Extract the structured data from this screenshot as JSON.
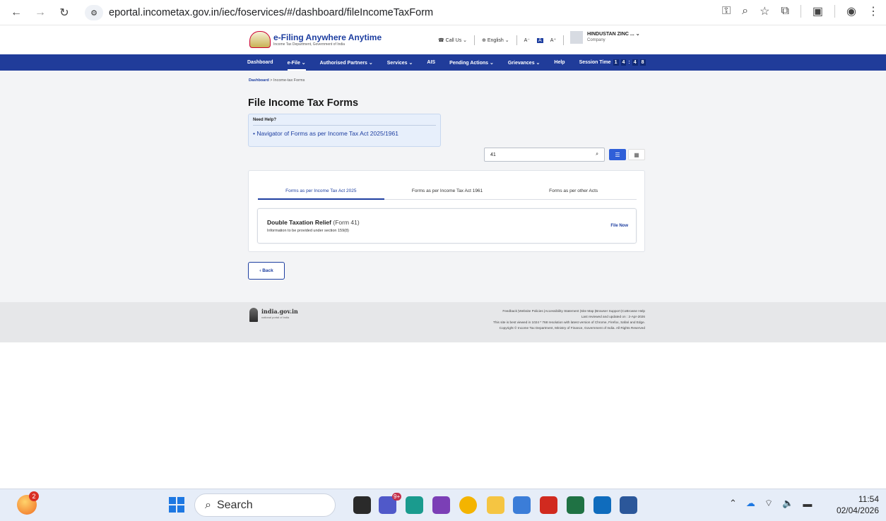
{
  "browser": {
    "url": "eportal.incometax.gov.in/iec/foservices/#/dashboard/fileIncomeTaxForm"
  },
  "header": {
    "logo_title": "e-Filing Anywhere Anytime",
    "logo_subtitle": "Income Tax Department, Government of India",
    "call_us": "Call Us",
    "language": "English",
    "font_small": "A⁻",
    "font_normal": "A",
    "font_large": "A⁺",
    "contrast": "◑",
    "user_name": "HINDUSTAN ZINC ...",
    "user_type": "Company"
  },
  "nav": {
    "items": [
      {
        "label": "Dashboard"
      },
      {
        "label": "e-File ⌄"
      },
      {
        "label": "Authorised Partners ⌄"
      },
      {
        "label": "Services ⌄"
      },
      {
        "label": "AIS"
      },
      {
        "label": "Pending Actions ⌄"
      },
      {
        "label": "Grievances ⌄"
      },
      {
        "label": "Help"
      }
    ],
    "session_label": "Session Time",
    "session_digits": [
      "1",
      "4",
      ":",
      "4",
      "8"
    ]
  },
  "main": {
    "breadcrumb": {
      "home": "Dashboard",
      "separator": ">",
      "current": "Income-tax Forms"
    },
    "title": "File Income Tax Forms",
    "help": {
      "title": "Need Help?",
      "link": "Navigator of Forms as per Income Tax Act 2025/1961"
    },
    "search": {
      "value": "41"
    },
    "tabs": [
      {
        "label": "Forms as per Income Tax Act 2025"
      },
      {
        "label": "Forms as per Income Tax Act 1961"
      },
      {
        "label": "Forms as per other Acts"
      }
    ],
    "form": {
      "name": "Double Taxation Relief",
      "code": "(Form 41)",
      "description": "Information to be provided under section 159(8)",
      "action": "File Now"
    },
    "back": "Back"
  },
  "footer": {
    "india_title": "india.gov.in",
    "india_sub": "national portal of india",
    "links": "Feedback |Website Policies |Accessibility Statement |Site Map |Browser Support |CoBrowse Help",
    "reviewed": "Last reviewed and updated on : 2-Apr-2026",
    "resolution": "This site is best viewed in 1024 * 768 resolution with latest version of Chrome, Firefox, Safari and Edge.",
    "copyright": "Copyright © Income Tax Department, Ministry of Finance, Government of India. All Rights Reserved"
  },
  "taskbar": {
    "search_placeholder": "Search",
    "badge_count": "2",
    "teams_badge": "9+",
    "time": "11:54",
    "date": "02/04/2026"
  },
  "colors": {
    "nav_blue": "#203c9a",
    "link_blue": "#1d3ea0",
    "page_bg": "#f3f4f6"
  }
}
